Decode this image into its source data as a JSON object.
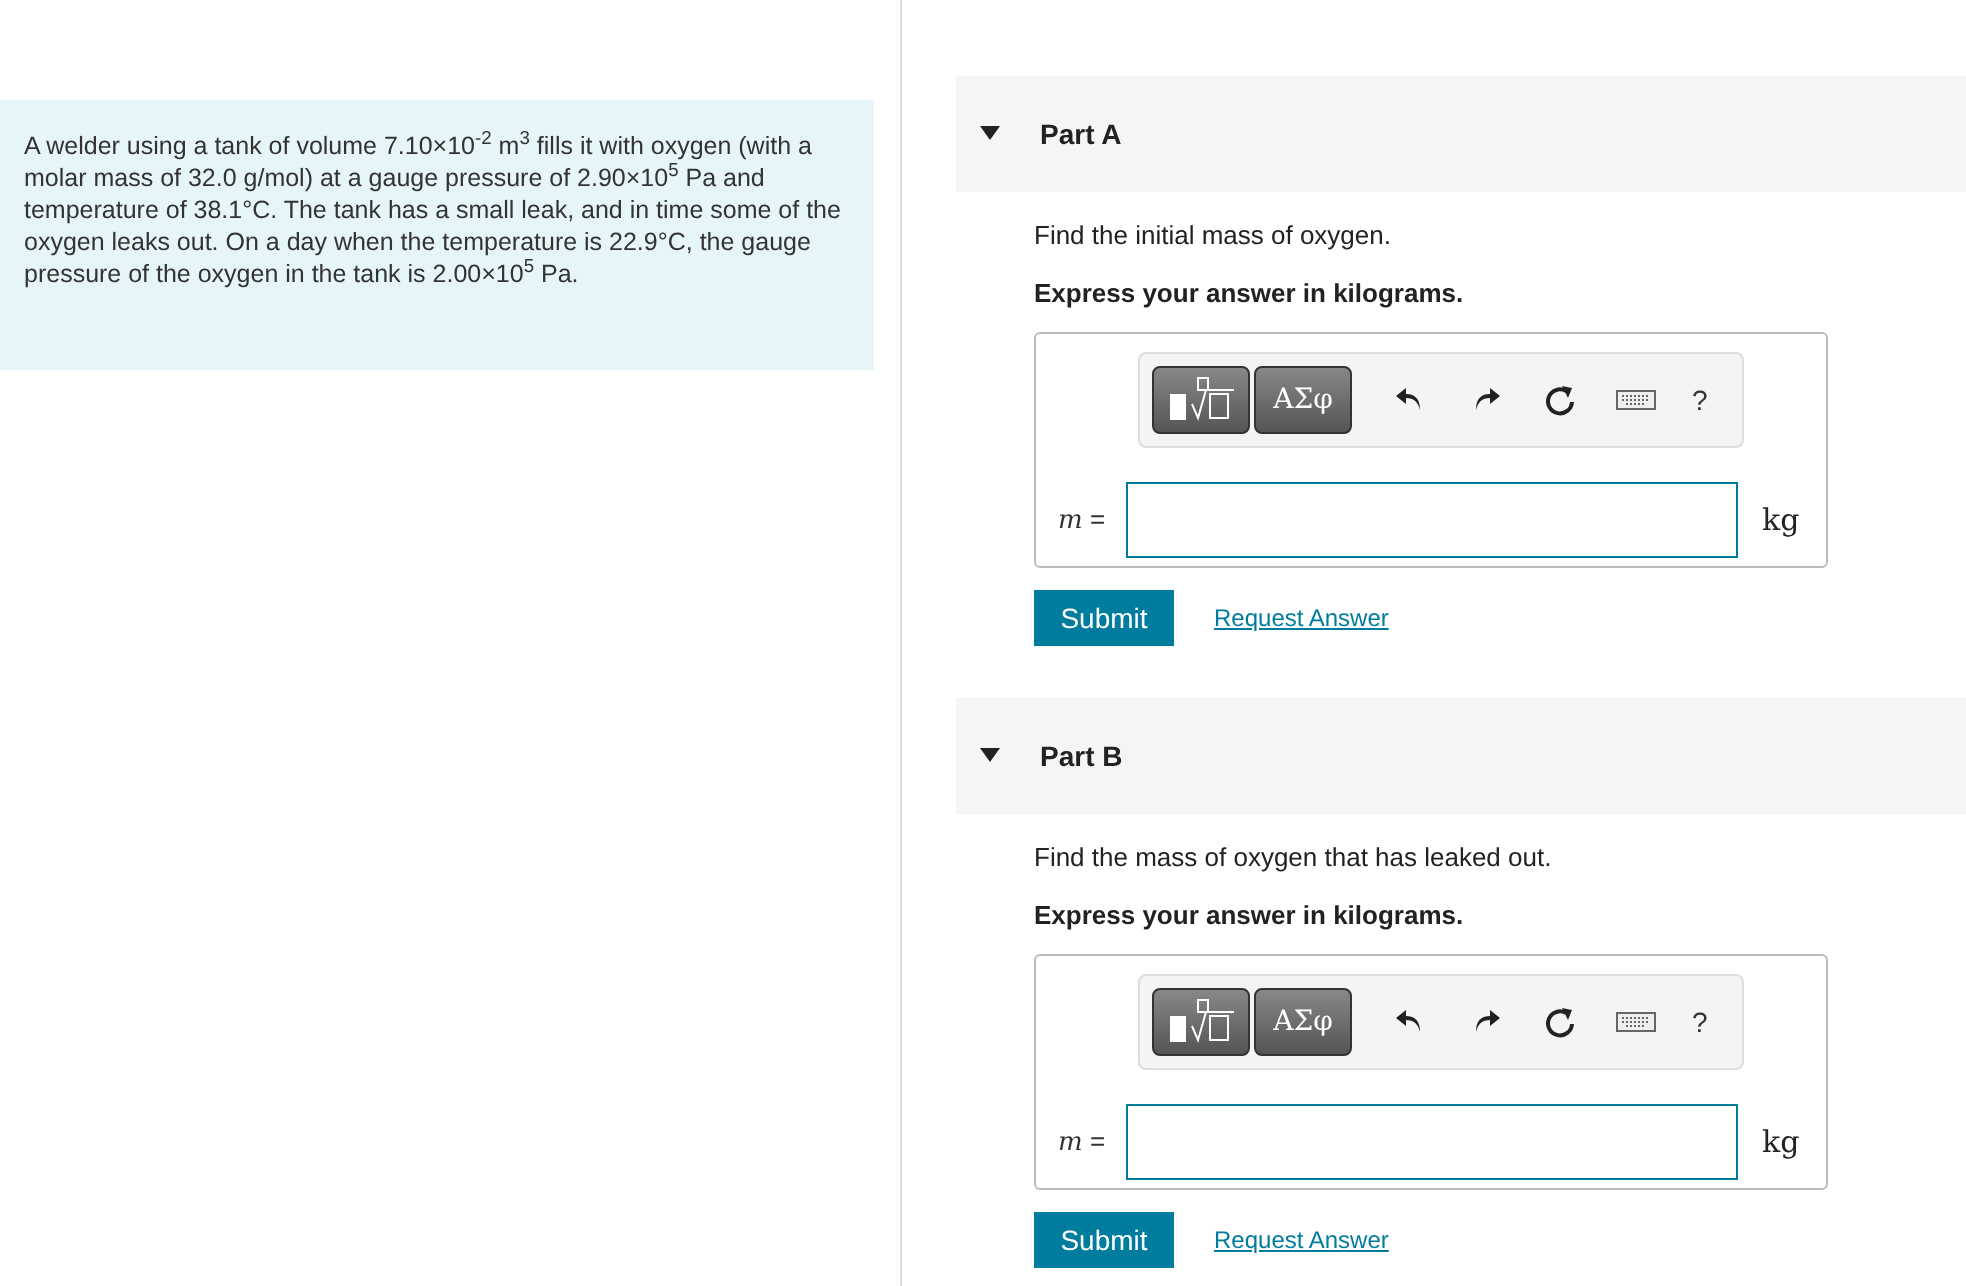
{
  "problem": {
    "text": "A welder using a tank of volume 7.10×10$^{-2}$ m$^{3}$ fills it with oxygen (with a molar mass of 32.0 g/mol) at a gauge pressure of 2.90×10$^{5}$ Pa and temperature of 38.1°C. The tank has a small leak, and in time some of the oxygen leaks out. On a day when the temperature is 22.9°C, the gauge pressure of the oxygen in the tank is 2.00×10$^{5}$ Pa."
  },
  "parts": [
    {
      "title": "Part A",
      "expanded": true,
      "question": "Find the initial mass of oxygen.",
      "instruction": "Express your answer in kilograms.",
      "symbols_button": "ΑΣφ",
      "help_button": "?",
      "variable": "m",
      "equals": "=",
      "unit": "kg",
      "submit": "Submit",
      "request": "Request Answer"
    },
    {
      "title": "Part B",
      "expanded": true,
      "question": "Find the mass of oxygen that has leaked out.",
      "instruction": "Express your answer in kilograms.",
      "symbols_button": "ΑΣφ",
      "help_button": "?",
      "variable": "m",
      "equals": "=",
      "unit": "kg",
      "submit": "Submit",
      "request": "Request Answer"
    }
  ]
}
